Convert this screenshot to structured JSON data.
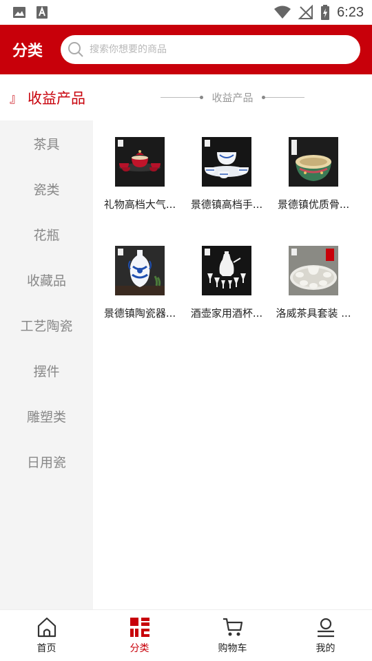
{
  "status_bar": {
    "time": "6:23"
  },
  "header": {
    "title": "分类",
    "search_placeholder": "搜索你想要的商品"
  },
  "section": {
    "mark": "』",
    "title": "收益产品",
    "subtitle": "收益产品"
  },
  "sidebar": {
    "items": [
      {
        "label": "茶具"
      },
      {
        "label": "瓷类"
      },
      {
        "label": "花瓶"
      },
      {
        "label": "收藏品"
      },
      {
        "label": "工艺陶瓷"
      },
      {
        "label": "摆件"
      },
      {
        "label": "雕塑类"
      },
      {
        "label": "日用瓷"
      }
    ]
  },
  "products": [
    {
      "name": "礼物高档大气..."
    },
    {
      "name": "景德镇高档手..."
    },
    {
      "name": "景德镇优质骨..."
    },
    {
      "name": "景德镇陶瓷器..."
    },
    {
      "name": "酒壶家用酒杯..."
    },
    {
      "name": "洛威茶具套装 ..."
    }
  ],
  "bottom_nav": {
    "items": [
      {
        "label": "首页",
        "icon": "home-icon"
      },
      {
        "label": "分类",
        "icon": "category-icon"
      },
      {
        "label": "购物车",
        "icon": "cart-icon"
      },
      {
        "label": "我的",
        "icon": "user-icon"
      }
    ],
    "active_index": 1
  },
  "colors": {
    "brand": "#c8000a",
    "sidebar_bg": "#f4f4f4",
    "inactive_text": "#888888"
  }
}
